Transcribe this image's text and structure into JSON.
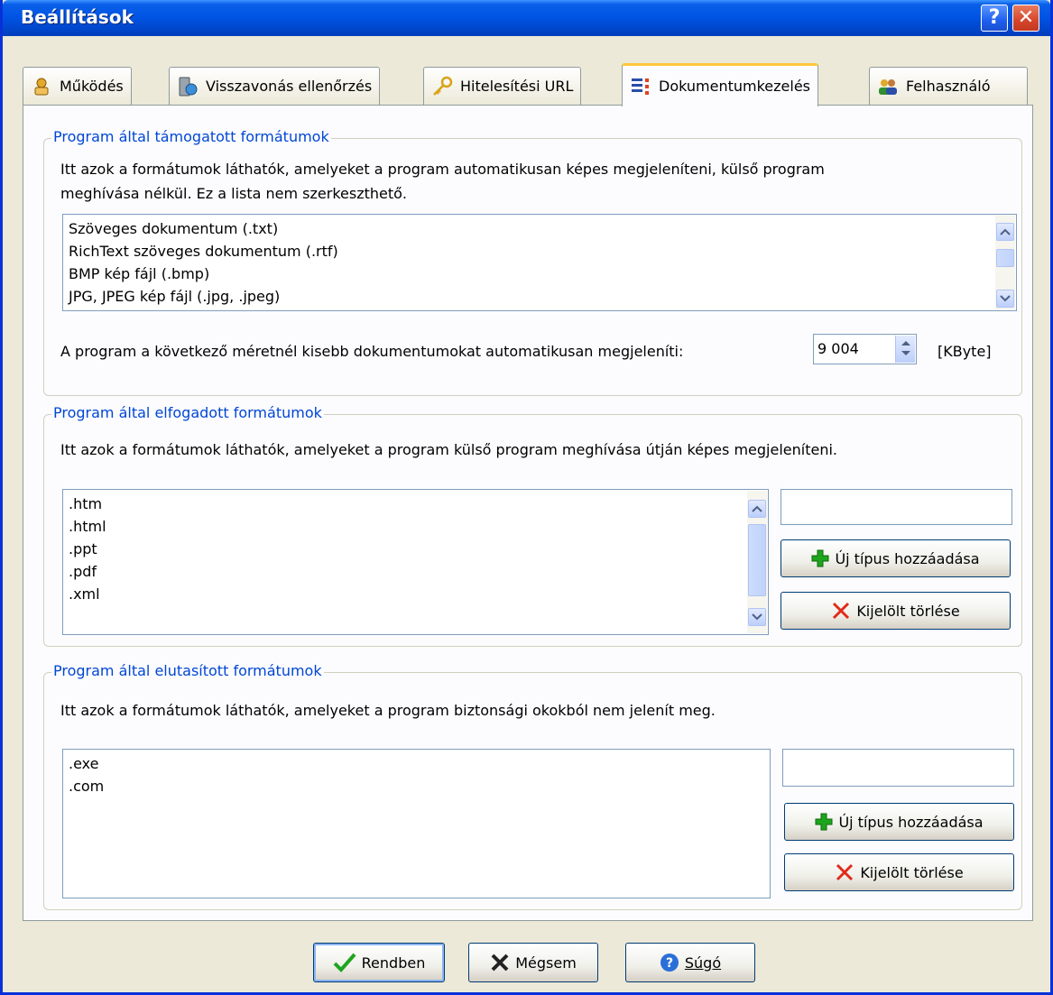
{
  "window": {
    "title": "Beállítások",
    "help_label": "?",
    "close_label": "✕"
  },
  "tabs": [
    {
      "label": "Működés",
      "icon": "gear-hand-icon"
    },
    {
      "label": "Visszavonás ellenőrzés",
      "icon": "server-globe-icon"
    },
    {
      "label": "Hitelesítési URL",
      "icon": "key-icon"
    },
    {
      "label": "Dokumentumkezelés",
      "icon": "document-list-icon",
      "active": true
    },
    {
      "label": "Felhasználó",
      "icon": "users-icon"
    }
  ],
  "supported": {
    "legend": "Program által támogatott formátumok",
    "description_line1": "Itt azok a formátumok láthatók, amelyeket a program automatikusan képes megjeleníteni, külső program",
    "description_line2": "meghívása nélkül. Ez a lista nem szerkeszthető.",
    "items": [
      "Szöveges dokumentum (.txt)",
      "RichText szöveges dokumentum (.rtf)",
      "BMP kép fájl (.bmp)",
      "JPG, JPEG kép fájl (.jpg, .jpeg)"
    ],
    "size_label": "A program a következő méretnél kisebb dokumentumokat automatikusan megjeleníti:",
    "size_value": "9 004",
    "size_unit": "[KByte]"
  },
  "accepted": {
    "legend": "Program által elfogadott formátumok",
    "description": "Itt azok a formátumok láthatók, amelyeket a program külső program meghívása útján képes megjeleníteni.",
    "items": [
      ".htm",
      ".html",
      ".ppt",
      ".pdf",
      ".xml"
    ],
    "new_value": "",
    "add_label": "Új típus hozzáadása",
    "delete_label": "Kijelölt törlése"
  },
  "rejected": {
    "legend": "Program által elutasított formátumok",
    "description": "Itt azok a formátumok láthatók, amelyeket a program biztonsági  okokból nem jelenít meg.",
    "items": [
      ".exe",
      ".com"
    ],
    "new_value": "",
    "add_label": "Új típus hozzáadása",
    "delete_label": "Kijelölt törlése"
  },
  "footer": {
    "ok_label": "Rendben",
    "cancel_label": "Mégsem",
    "help_label": "Súgó"
  },
  "colors": {
    "title_bar": "#0055e5",
    "legend_text": "#0046d5",
    "add_icon": "#1ea51e",
    "delete_icon": "#e02a1a",
    "ok_icon": "#1ea51e",
    "active_tab_accent": "#ffc83c"
  }
}
